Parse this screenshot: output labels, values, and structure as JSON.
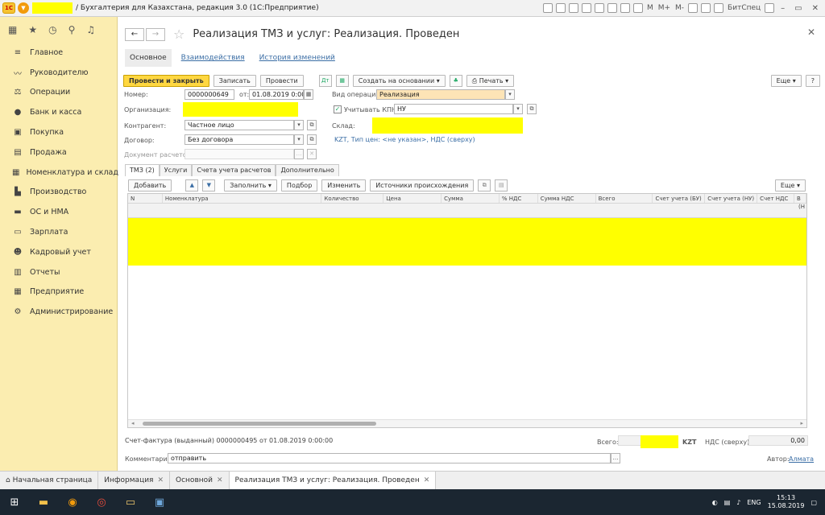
{
  "window": {
    "title": "/ Бухгалтерия для Казахстана, редакция 3.0 (1С:Предприятие)",
    "toolbar_text": [
      "M",
      "M+",
      "M-"
    ],
    "user": "БитСпец"
  },
  "sidebar": {
    "items": [
      {
        "label": "Главное",
        "icon": "menu-icon"
      },
      {
        "label": "Руководителю",
        "icon": "chart-icon"
      },
      {
        "label": "Операции",
        "icon": "scales-icon"
      },
      {
        "label": "Банк и касса",
        "icon": "coin-icon"
      },
      {
        "label": "Покупка",
        "icon": "cart-icon"
      },
      {
        "label": "Продажа",
        "icon": "bag-icon"
      },
      {
        "label": "Номенклатура и склад",
        "icon": "grid-icon"
      },
      {
        "label": "Производство",
        "icon": "factory-icon"
      },
      {
        "label": "ОС и НМА",
        "icon": "truck-icon"
      },
      {
        "label": "Зарплата",
        "icon": "wallet-icon"
      },
      {
        "label": "Кадровый учет",
        "icon": "people-icon"
      },
      {
        "label": "Отчеты",
        "icon": "report-icon"
      },
      {
        "label": "Предприятие",
        "icon": "building-icon"
      },
      {
        "label": "Администрирование",
        "icon": "gear-icon"
      }
    ]
  },
  "document": {
    "title": "Реализация ТМЗ и услуг: Реализация. Проведен",
    "tabs": [
      "Основное",
      "Взаимодействия",
      "История изменений"
    ]
  },
  "commands": {
    "post_close": "Провести и закрыть",
    "save": "Записать",
    "post": "Провести",
    "create_based": "Создать на основании",
    "print": "Печать",
    "more": "Еще",
    "help": "?"
  },
  "form": {
    "number_label": "Номер:",
    "number": "0000000649",
    "date_label": "от:",
    "date": "01.08.2019  0:00:00",
    "op_label": "Вид операции:",
    "op_value": "Реализация",
    "org_label": "Организация:",
    "kpn_label": "Учитывать КПН",
    "kpn_value": "НУ",
    "contractor_label": "Контрагент:",
    "contractor": "Частное лицо",
    "warehouse_label": "Склад:",
    "contract_label": "Договор:",
    "contract": "Без договора",
    "prices_link": "KZT, Тип цен: <не указан>, НДС (сверху)",
    "settlement_label": "Документ расчетов:"
  },
  "inner_tabs": [
    "ТМЗ (2)",
    "Услуги",
    "Счета учета расчетов",
    "Дополнительно"
  ],
  "table": {
    "commands": [
      "Добавить",
      "Заполнить",
      "Подбор",
      "Изменить",
      "Источники происхождения"
    ],
    "more": "Еще",
    "columns": [
      "N",
      "Номенклатура",
      "Количество",
      "Цена",
      "Сумма",
      "% НДС",
      "Сумма НДС",
      "Всего",
      "Счет учета (БУ)",
      "Счет учета (НУ)",
      "Счет НДС",
      "В"
    ],
    "col_extra": "(Н"
  },
  "footer": {
    "invoice": "Счет-фактура (выданный) 0000000495 от 01.08.2019 0:00:00",
    "total_label": "Всего:",
    "currency": "KZT",
    "vat_label": "НДС (сверху):",
    "vat_value": "0,00",
    "comment_label": "Комментарий:",
    "comment": "отправить",
    "author_label": "Автор:",
    "author": "Алмата"
  },
  "open_tabs": [
    {
      "label": "Начальная страница",
      "closable": false
    },
    {
      "label": "Информация",
      "closable": true
    },
    {
      "label": "Основной",
      "closable": true
    },
    {
      "label": "Реализация ТМЗ и услуг: Реализация. Проведен",
      "closable": true
    }
  ],
  "taskbar": {
    "lang": "ENG",
    "time": "15:13",
    "date": "15.08.2019"
  }
}
